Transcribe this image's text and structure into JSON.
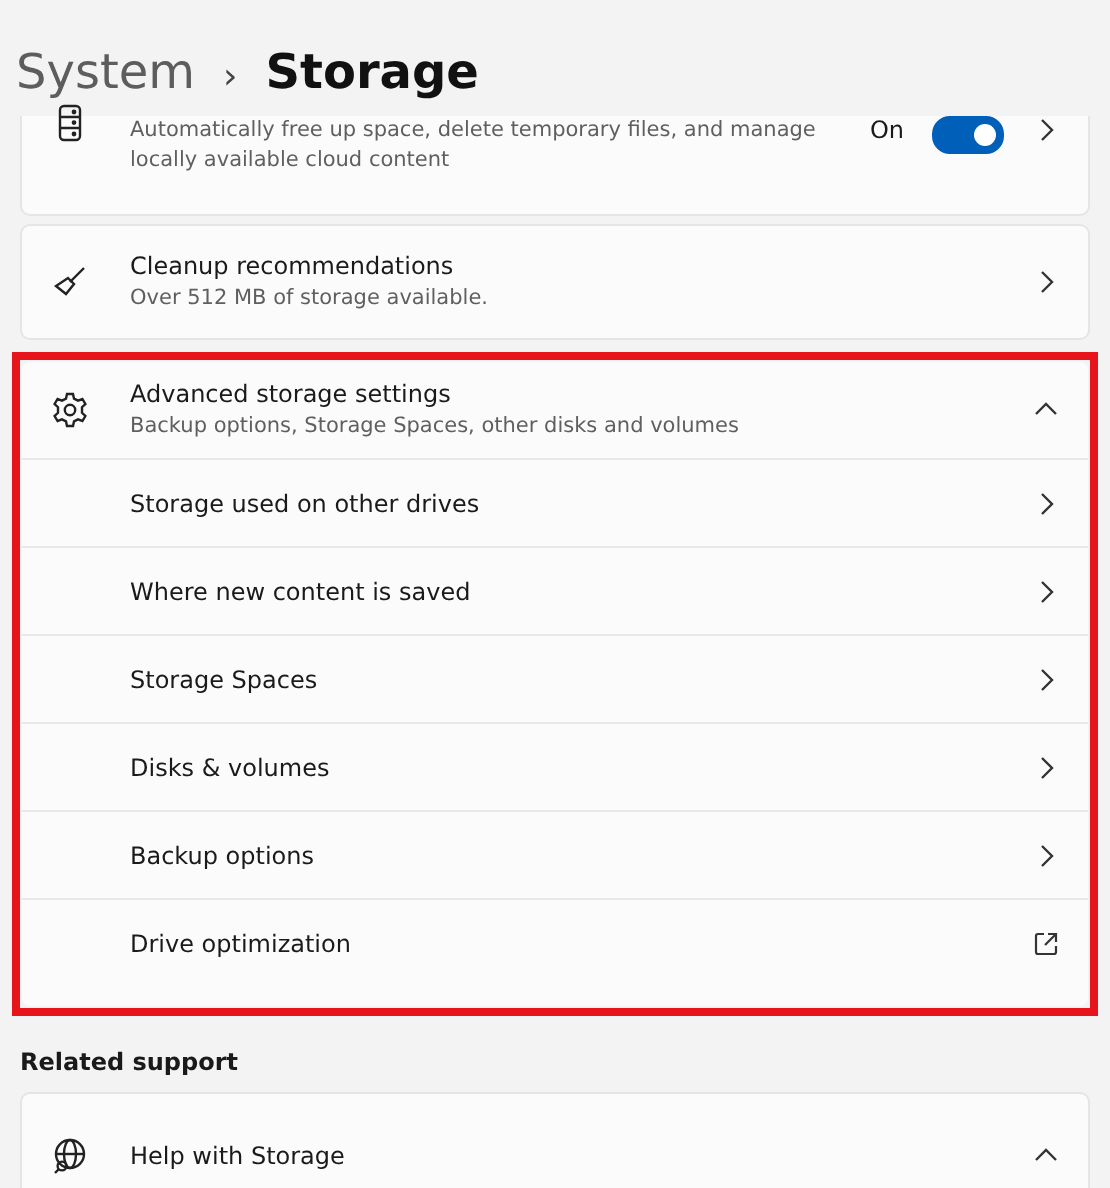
{
  "breadcrumb": {
    "parent": "System",
    "separator": "›",
    "current": "Storage"
  },
  "storage_sense": {
    "description": "Automatically free up space, delete temporary files, and manage locally available cloud content",
    "toggle_label": "On",
    "on": true
  },
  "cleanup": {
    "title": "Cleanup recommendations",
    "description": "Over 512 MB of storage available."
  },
  "advanced": {
    "title": "Advanced storage settings",
    "description": "Backup options, Storage Spaces, other disks and volumes",
    "expanded": true,
    "highlighted": true,
    "items": [
      {
        "label": "Storage used on other drives",
        "kind": "chevron"
      },
      {
        "label": "Where new content is saved",
        "kind": "chevron"
      },
      {
        "label": "Storage Spaces",
        "kind": "chevron"
      },
      {
        "label": "Disks & volumes",
        "kind": "chevron"
      },
      {
        "label": "Backup options",
        "kind": "chevron"
      },
      {
        "label": "Drive optimization",
        "kind": "external"
      }
    ]
  },
  "related_support": {
    "heading": "Related support",
    "items": [
      {
        "title": "Help with Storage",
        "expanded": true
      }
    ]
  }
}
